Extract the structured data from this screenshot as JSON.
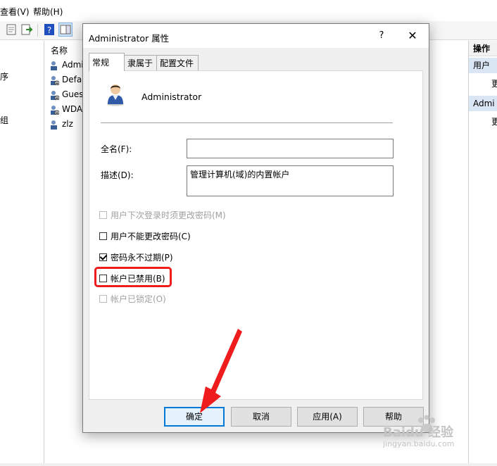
{
  "menu": {
    "view": "查看(V)",
    "help": "帮助(H)"
  },
  "left_pane": {
    "items": [
      "序",
      "组"
    ]
  },
  "middle_pane": {
    "column_header": "名称",
    "users": [
      "Admi",
      "Defau",
      "Gues",
      "WDA",
      "zlz"
    ]
  },
  "right_pane": {
    "header": "操作",
    "sections": [
      {
        "title": "用户",
        "item": "更"
      },
      {
        "title": "Admi",
        "item": "更"
      }
    ]
  },
  "dialog": {
    "title": "Administrator 属性",
    "help_glyph": "?",
    "close_glyph": "✕",
    "tabs": [
      "常规",
      "隶属于",
      "配置文件"
    ],
    "username": "Administrator",
    "fullname_label": "全名(F):",
    "fullname_value": "",
    "description_label": "描述(D):",
    "description_value": "管理计算机(域)的内置帐户",
    "checkboxes": [
      {
        "label": "用户下次登录时须更改密码(M)",
        "checked": false,
        "disabled": true
      },
      {
        "label": "用户不能更改密码(C)",
        "checked": false,
        "disabled": false
      },
      {
        "label": "密码永不过期(P)",
        "checked": true,
        "disabled": false
      },
      {
        "label": "帐户已禁用(B)",
        "checked": false,
        "disabled": false
      },
      {
        "label": "帐户已锁定(O)",
        "checked": false,
        "disabled": true
      }
    ],
    "buttons": {
      "ok": "确定",
      "cancel": "取消",
      "apply": "应用(A)",
      "help": "帮助"
    }
  },
  "watermark": {
    "brand": "Baidu 经验",
    "url": "jingyan.baidu.com"
  },
  "colors": {
    "highlight": "#ee1c1c",
    "accent": "#0078d7",
    "dialog_bg": "#f0f0f0"
  }
}
